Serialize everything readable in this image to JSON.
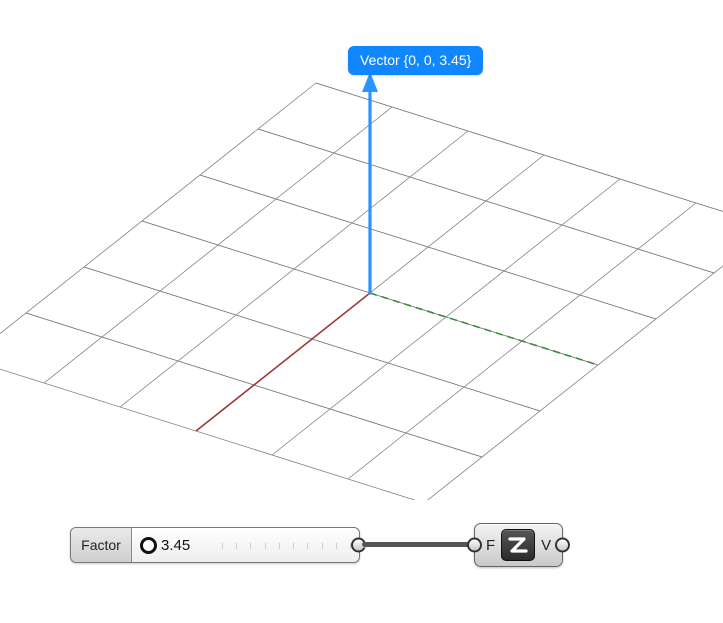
{
  "tooltip": {
    "text": "Vector {0, 0, 3.45}"
  },
  "slider": {
    "label": "Factor",
    "value": "3.45"
  },
  "node": {
    "input_label": "F",
    "output_label": "V",
    "icon": "z-axis-icon"
  },
  "viewport": {
    "axes": {
      "x": "red",
      "y": "green",
      "z": "blue"
    }
  }
}
